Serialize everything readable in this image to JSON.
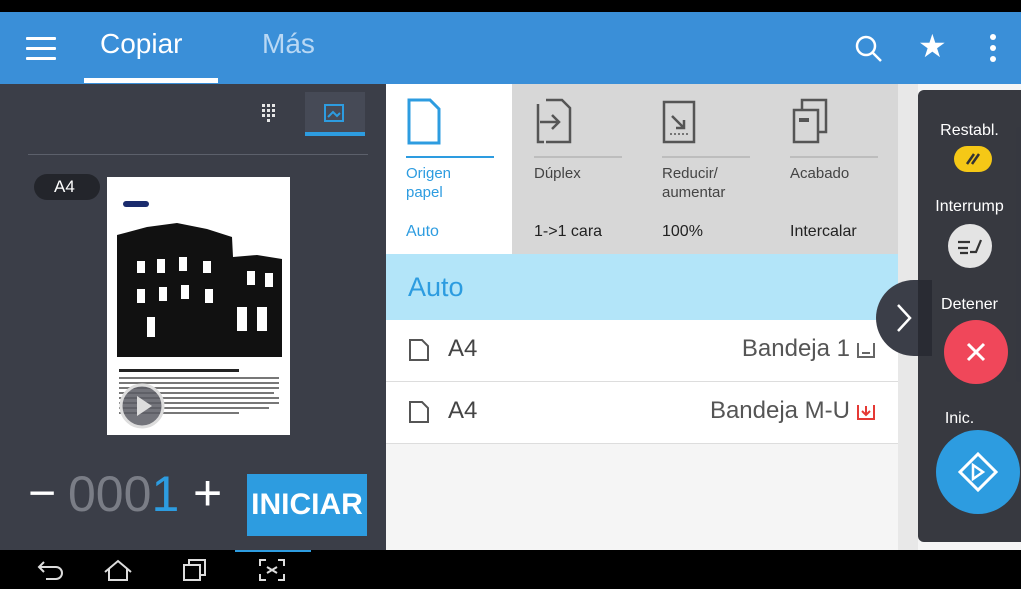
{
  "header": {
    "tabs": [
      {
        "label": "Copiar",
        "active": true
      },
      {
        "label": "Más",
        "active": false
      }
    ],
    "icons": [
      "menu-icon",
      "search-icon",
      "star-icon",
      "overflow-menu-icon"
    ]
  },
  "preview": {
    "paper_size_badge": "A4",
    "counter_minus": "−",
    "counter_digits": "000",
    "counter_last_digit": "1",
    "counter_plus": "+",
    "start_button": "INICIAR"
  },
  "options": [
    {
      "name_line1": "Origen",
      "name_line2": "papel",
      "value": "Auto",
      "icon": "paper-source-icon",
      "active": true
    },
    {
      "name_line1": "Dúplex",
      "name_line2": "",
      "value": "1->1 cara",
      "icon": "duplex-icon",
      "active": false
    },
    {
      "name_line1": "Reducir/",
      "name_line2": "aumentar",
      "value": "100%",
      "icon": "reduce-enlarge-icon",
      "active": false
    },
    {
      "name_line1": "Acabado",
      "name_line2": "",
      "value": "Intercalar",
      "icon": "finishing-icon",
      "active": false
    }
  ],
  "selected_source": "Auto",
  "trays": [
    {
      "size": "A4",
      "tray": "Bandeja 1",
      "status": "normal"
    },
    {
      "size": "A4",
      "tray": "Bandeja M-U",
      "status": "empty"
    }
  ],
  "quick_actions": {
    "reset": "Restabl.",
    "interrupt": "Interrump",
    "stop": "Detener",
    "start": "Inic."
  },
  "colors": {
    "accent": "#2d9ce0",
    "header": "#3a8fd8",
    "stop": "#f0475a",
    "reset": "#f5c816"
  }
}
